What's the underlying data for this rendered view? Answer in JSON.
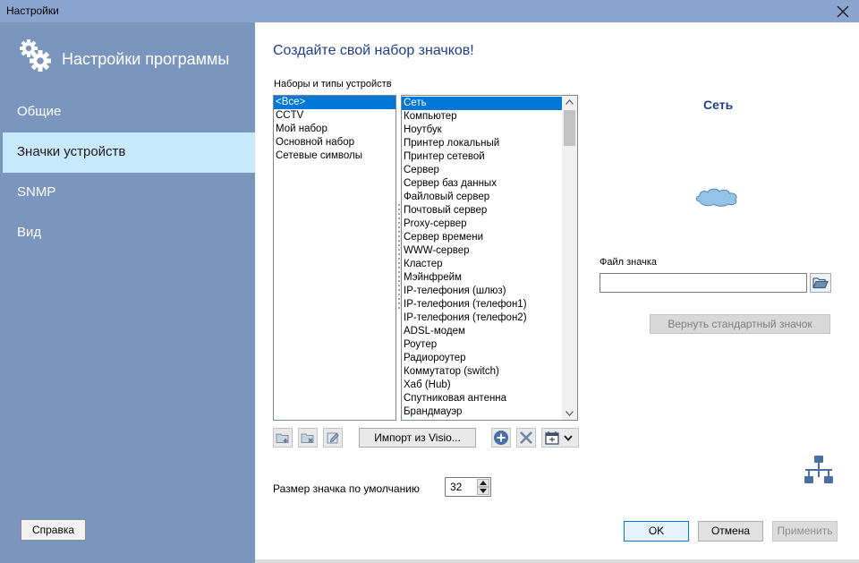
{
  "window": {
    "title": "Настройки"
  },
  "sidebar": {
    "header": "Настройки программы",
    "items": [
      {
        "label": "Общие",
        "active": false
      },
      {
        "label": "Значки устройств",
        "active": true
      },
      {
        "label": "SNMP",
        "active": false
      },
      {
        "label": "Вид",
        "active": false
      }
    ],
    "help_label": "Справка"
  },
  "main": {
    "title": "Создайте свой набор значков!",
    "sets_label": "Наборы и типы устройств",
    "sets": [
      "<Все>",
      "CCTV",
      "Мой набор",
      "Основной набор",
      "Сетевые символы"
    ],
    "selected_set": 0,
    "devices": [
      "Сеть",
      "Компьютер",
      "Ноутбук",
      "Принтер локальный",
      "Принтер сетевой",
      "Сервер",
      "Сервер баз данных",
      "Файловый сервер",
      "Почтовый сервер",
      "Proxy-сервер",
      "Сервер времени",
      "WWW-сервер",
      "Кластер",
      "Мэйнфрейм",
      "IP-телефония (шлюз)",
      "IP-телефония (телефон1)",
      "IP-телефония (телефон2)",
      "ADSL-модем",
      "Роутер",
      "Радиороутер",
      "Коммутатор (switch)",
      "Хаб (Hub)",
      "Спутниковая антенна",
      "Брандмауэр"
    ],
    "selected_device": 0,
    "import_label": "Импорт из Visio...",
    "preview_name": "Сеть",
    "file_label": "Файл значка",
    "file_value": "",
    "restore_label": "Вернуть стандартный значок",
    "size_label": "Размер значка по умолчанию",
    "size_value": "32"
  },
  "footer": {
    "ok_label": "OK",
    "cancel_label": "Отмена",
    "apply_label": "Применить"
  },
  "colors": {
    "titlebar": "#8aa5cf",
    "sidebar": "#7a95be",
    "active_item": "#c8e8fb",
    "selection": "#0078d7",
    "title_text": "#1f3f8c"
  }
}
